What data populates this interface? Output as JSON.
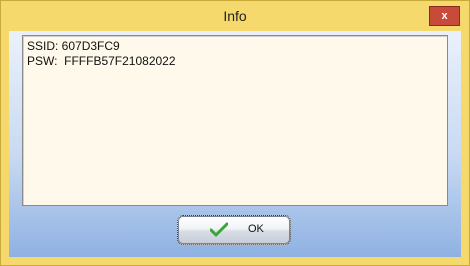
{
  "window": {
    "title": "Info",
    "close_label": "x"
  },
  "content": {
    "lines": [
      "SSID: 607D3FC9",
      "PSW:  FFFFB57F21082022"
    ]
  },
  "buttons": {
    "ok_label": "OK",
    "ok_icon": "checkmark-icon"
  },
  "colors": {
    "title_bar": "#f6d96c",
    "close_button": "#c74a3b",
    "text_background": "#fff9ec",
    "client_gradient_bottom": "#8fb1e2",
    "checkmark": "#3aa53a"
  }
}
